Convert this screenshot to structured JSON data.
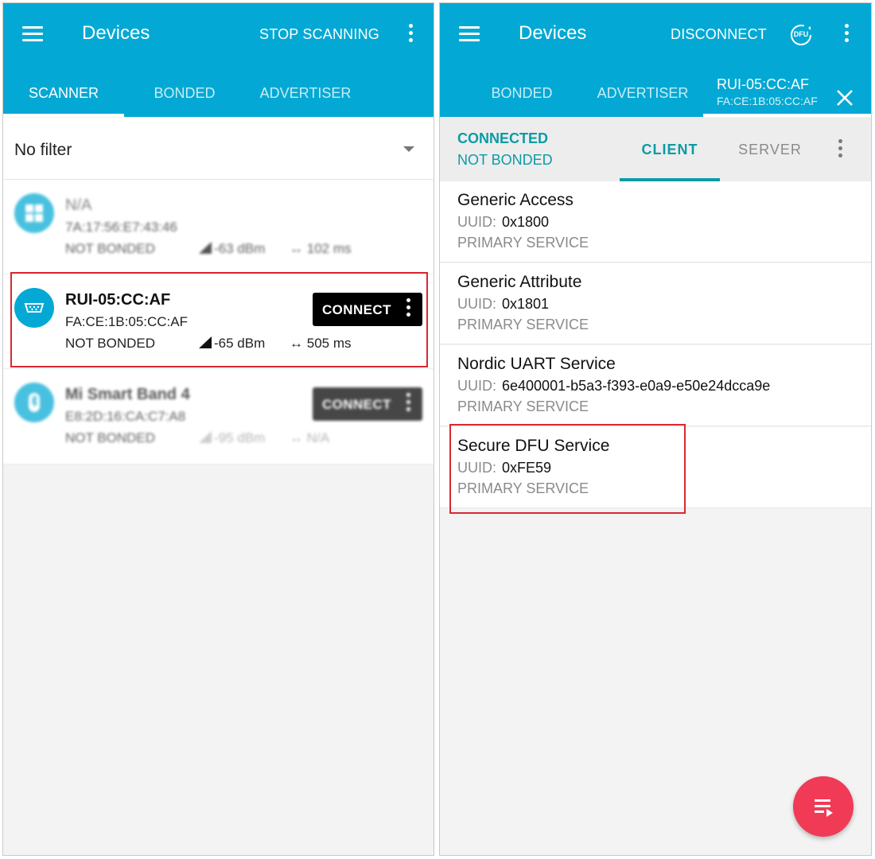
{
  "left": {
    "title": "Devices",
    "action": "STOP SCANNING",
    "tabs": [
      "SCANNER",
      "BONDED",
      "ADVERTISER"
    ],
    "filter": "No filter",
    "devices": [
      {
        "name": "N/A",
        "address": "7A:17:56:E7:43:46",
        "bond": "NOT BONDED",
        "rssi": "-63 dBm",
        "interval": "102 ms",
        "connect": ""
      },
      {
        "name": "RUI-05:CC:AF",
        "address": "FA:CE:1B:05:CC:AF",
        "bond": "NOT BONDED",
        "rssi": "-65 dBm",
        "interval": "505 ms",
        "connect": "CONNECT"
      },
      {
        "name": "Mi Smart Band 4",
        "address": "E8:2D:16:CA:C7:A8",
        "bond": "NOT BONDED",
        "rssi": "-95 dBm",
        "interval": "N/A",
        "connect": "CONNECT"
      }
    ]
  },
  "right": {
    "title": "Devices",
    "action": "DISCONNECT",
    "dfu_label": "DFU",
    "tabs": [
      "BONDED",
      "ADVERTISER"
    ],
    "device_tab": {
      "name": "RUI-05:CC:AF",
      "address": "FA:CE:1B:05:CC:AF"
    },
    "status": {
      "connection": "CONNECTED",
      "bond": "NOT BONDED"
    },
    "client_tabs": [
      "CLIENT",
      "SERVER"
    ],
    "uuid_label": "UUID:",
    "services": [
      {
        "name": "Generic Access",
        "uuid": "0x1800",
        "type": "PRIMARY SERVICE"
      },
      {
        "name": "Generic Attribute",
        "uuid": "0x1801",
        "type": "PRIMARY SERVICE"
      },
      {
        "name": "Nordic UART Service",
        "uuid": "6e400001-b5a3-f393-e0a9-e50e24dcca9e",
        "type": "PRIMARY SERVICE"
      },
      {
        "name": "Secure DFU Service",
        "uuid": "0xFE59",
        "type": "PRIMARY SERVICE"
      }
    ]
  },
  "colors": {
    "appbar": "#03a9d4",
    "accent": "#0c9ba5",
    "fab": "#f03a56",
    "highlight": "#d9282f"
  },
  "icons": [
    "menu-icon",
    "more-vert-icon",
    "dfu-icon",
    "close-icon",
    "windows-logo-icon",
    "serial-port-icon",
    "bluetooth-icon",
    "signal-strength-icon",
    "interval-arrows-icon",
    "log-list-icon"
  ]
}
